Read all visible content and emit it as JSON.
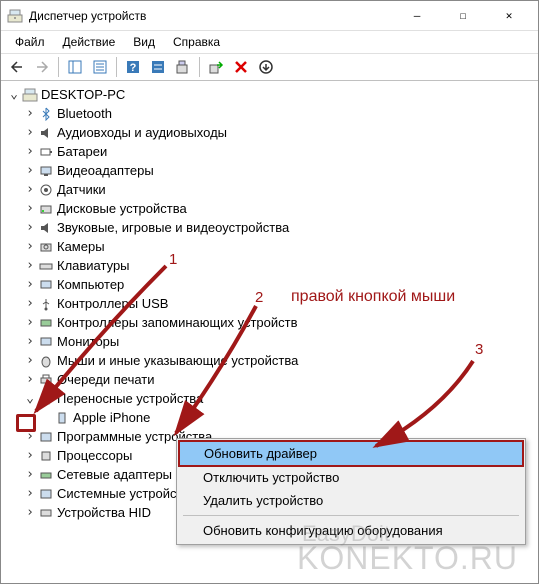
{
  "window": {
    "title": "Диспетчер устройств"
  },
  "menu": {
    "file": "Файл",
    "action": "Действие",
    "view": "Вид",
    "help": "Справка"
  },
  "tree": {
    "root": "DESKTOP-PC",
    "items": [
      "Bluetooth",
      "Аудиовходы и аудиовыходы",
      "Батареи",
      "Видеоадаптеры",
      "Датчики",
      "Дисковые устройства",
      "Звуковые, игровые и видеоустройства",
      "Камеры",
      "Клавиатуры",
      "Компьютер",
      "Контроллеры USB",
      "Контроллеры запоминающих устройств",
      "Мониторы",
      "Мыши и иные указывающие устройства",
      "Очереди печати",
      "Переносные устройства",
      "Программные устройства",
      "Процессоры",
      "Сетевые адаптеры",
      "Системные устройства",
      "Устройства HID"
    ],
    "portable_child": "Apple iPhone"
  },
  "context": {
    "update_driver": "Обновить драйвер",
    "disable_device": "Отключить устройство",
    "uninstall_device": "Удалить устройство",
    "scan_hardware": "Обновить конфигурацию оборудования"
  },
  "annotations": {
    "n1": "1",
    "n2": "2",
    "n3": "3",
    "right_click": "правой кнопкой мыши"
  },
  "watermark": {
    "main": "KONEKTO.RU",
    "sub": "EasyDoit"
  }
}
